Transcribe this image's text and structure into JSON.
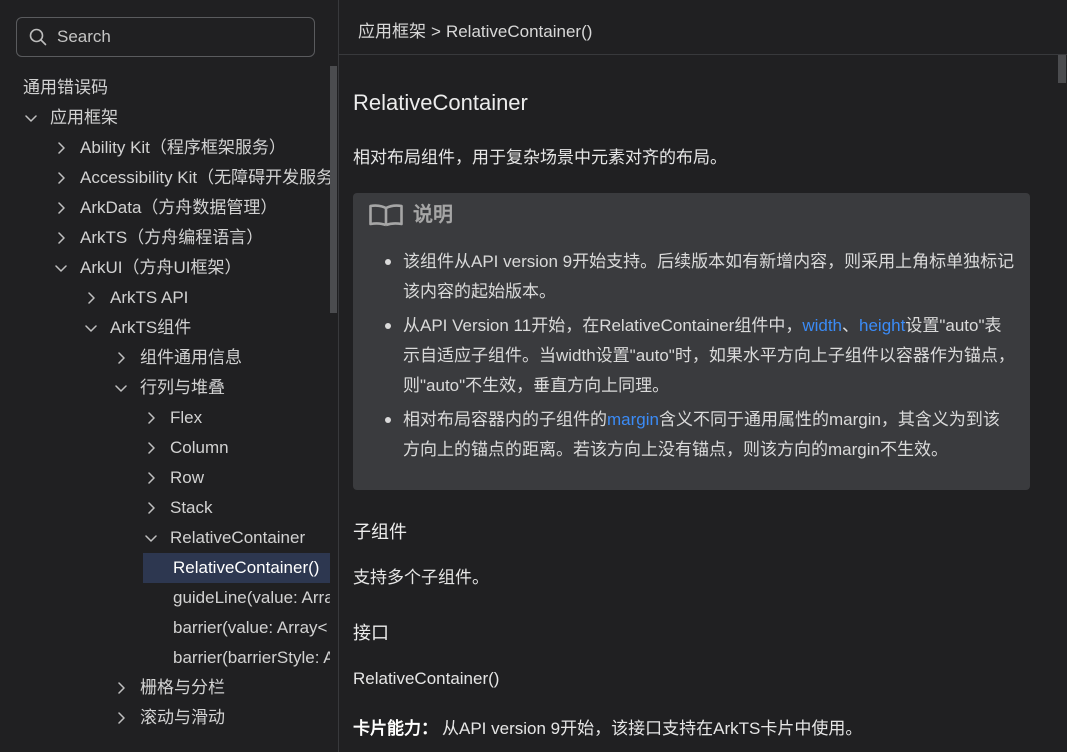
{
  "theme": {
    "background": "#202022",
    "divider": "#38393c",
    "text": "#e6e6e6",
    "sidebar_text": "#d2d2d2",
    "note_background": "#3a3b3e",
    "note_heading": "#a6a6a6",
    "selected_background": "#2d3750",
    "selected_text": "#ffffff",
    "link": "#3b8bf6",
    "scrollbar_thumb": "#4b4c4f"
  },
  "sidebar": {
    "search": {
      "icon": "search-icon",
      "placeholder": "Search"
    },
    "nav_tree": [
      {
        "label": "通用错误码"
      },
      {
        "label": "应用框架",
        "expandable": true,
        "expanded": true,
        "children": [
          {
            "label": "Ability Kit（程序框架服务）",
            "expandable": true,
            "expanded": false
          },
          {
            "label": "Accessibility Kit（无障碍开发服务",
            "expandable": true,
            "expanded": false
          },
          {
            "label": "ArkData（方舟数据管理）",
            "expandable": true,
            "expanded": false
          },
          {
            "label": "ArkTS（方舟编程语言）",
            "expandable": true,
            "expanded": false
          },
          {
            "label": "ArkUI（方舟UI框架）",
            "expandable": true,
            "expanded": true,
            "children": [
              {
                "label": "ArkTS API",
                "expandable": true,
                "expanded": false
              },
              {
                "label": "ArkTS组件",
                "expandable": true,
                "expanded": true,
                "children": [
                  {
                    "label": "组件通用信息",
                    "expandable": true,
                    "expanded": false
                  },
                  {
                    "label": "行列与堆叠",
                    "expandable": true,
                    "expanded": true,
                    "children": [
                      {
                        "label": "Flex",
                        "expandable": true,
                        "expanded": false
                      },
                      {
                        "label": "Column",
                        "expandable": true,
                        "expanded": false
                      },
                      {
                        "label": "Row",
                        "expandable": true,
                        "expanded": false
                      },
                      {
                        "label": "Stack",
                        "expandable": true,
                        "expanded": false
                      },
                      {
                        "label": "RelativeContainer",
                        "expandable": true,
                        "expanded": true,
                        "children": [
                          {
                            "label": "RelativeContainer()",
                            "selected": true
                          },
                          {
                            "label": "guideLine(value: Arra"
                          },
                          {
                            "label": "barrier(value: Array<"
                          },
                          {
                            "label": "barrier(barrierStyle: A"
                          }
                        ]
                      }
                    ]
                  },
                  {
                    "label": "栅格与分栏",
                    "expandable": true,
                    "expanded": false
                  },
                  {
                    "label": "滚动与滑动",
                    "expandable": true,
                    "expanded": false
                  }
                ]
              }
            ]
          }
        ]
      }
    ]
  },
  "breadcrumb": {
    "parent": "应用框架",
    "separator": ">",
    "current": "RelativeContainer()"
  },
  "article": {
    "title": "RelativeContainer",
    "description": "相对布局组件，用于复杂场景中元素对齐的布局。",
    "note": {
      "icon": "book-open-icon",
      "heading": "说明",
      "items": [
        [
          {
            "text": "该组件从API version 9开始支持。后续版本如有新增内容，则采用上角标单独标记该内容的起始版本。"
          }
        ],
        [
          {
            "text": "从API Version 11开始，在RelativeContainer组件中，"
          },
          {
            "text": "width",
            "link": true
          },
          {
            "text": "、"
          },
          {
            "text": "height",
            "link": true
          },
          {
            "text": "设置\"auto\"表示自适应子组件。当width设置\"auto\"时，如果水平方向上子组件以容器作为锚点，则\"auto\"不生效，垂直方向上同理。"
          }
        ],
        [
          {
            "text": "相对布局容器内的子组件的"
          },
          {
            "text": "margin",
            "link": true
          },
          {
            "text": "含义不同于通用属性的margin，其含义为到该方向上的锚点的距离。若该方向上没有锚点，则该方向的margin不生效。"
          }
        ]
      ]
    },
    "subcomponents": {
      "heading": "子组件",
      "text": "支持多个子组件。"
    },
    "interface": {
      "heading": "接口",
      "signature": "RelativeContainer()"
    },
    "card_capability": {
      "label": "卡片能力：",
      "text": "从API version 9开始，该接口支持在ArkTS卡片中使用。"
    }
  },
  "scroll": {
    "sidebar": {
      "scrolled_percent": 0,
      "visible_percent": 36
    },
    "content": {
      "scrolled_percent": 0,
      "visible_percent": 4
    }
  }
}
